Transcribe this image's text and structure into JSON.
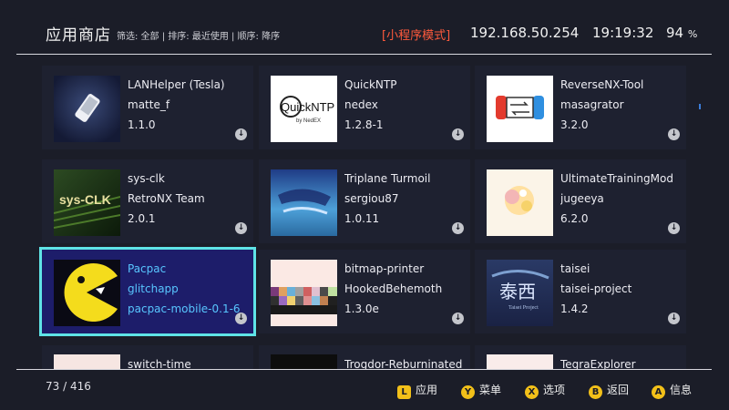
{
  "header": {
    "title": "应用商店",
    "filter_info": "筛选: 全部 | 排序: 最近使用 | 顺序: 降序",
    "mode": "[小程序模式]",
    "ip": "192.168.50.254",
    "time": "19:19:32",
    "battery": "94",
    "battery_unit": "%"
  },
  "apps": [
    {
      "name": "LANHelper (Tesla)",
      "author": "matte_f",
      "version": "1.1.0",
      "icon": "phone-icon"
    },
    {
      "name": "QuickNTP",
      "author": "nedex",
      "version": "1.2.8-1",
      "icon": "quickntp-logo"
    },
    {
      "name": "ReverseNX-Tool",
      "author": "masagrator",
      "version": "3.2.0",
      "icon": "reversenx-logo"
    },
    {
      "name": "sys-clk",
      "author": "RetroNX Team",
      "version": "2.0.1",
      "icon": "sys-clk-logo"
    },
    {
      "name": "Triplane Turmoil",
      "author": "sergiou87",
      "version": "1.0.11",
      "icon": "triplane-logo"
    },
    {
      "name": "UltimateTrainingMod",
      "author": "jugeeya",
      "version": "6.2.0",
      "icon": "training-mod-logo"
    },
    {
      "name": "Pacpac",
      "author": "glitchapp",
      "version": "pacpac-mobile-0.1-6",
      "icon": "pacman-icon"
    },
    {
      "name": "bitmap-printer",
      "author": "HookedBehemoth",
      "version": "1.3.0e",
      "icon": "bitmap-printer-logo"
    },
    {
      "name": "taisei",
      "author": "taisei-project",
      "version": "1.4.2",
      "icon": "taisei-logo"
    },
    {
      "name": "switch-time",
      "author": "",
      "version": "",
      "icon": ""
    },
    {
      "name": "Trogdor-Reburninated",
      "author": "",
      "version": "",
      "icon": ""
    },
    {
      "name": "TegraExplorer",
      "author": "",
      "version": "",
      "icon": ""
    }
  ],
  "taisei_logo_text": "泰西",
  "taisei_logo_sub": "Taisei Project",
  "quickntp_logo_text": "QuickNTP",
  "quickntp_logo_sub": "by NedEX",
  "sysclk_logo_text": "sys-CLK",
  "footer": {
    "count": "73 / 416",
    "hints": [
      {
        "key": "L",
        "label": "应用"
      },
      {
        "key": "Y",
        "label": "菜单"
      },
      {
        "key": "X",
        "label": "选项"
      },
      {
        "key": "B",
        "label": "返回"
      },
      {
        "key": "A",
        "label": "信息"
      }
    ]
  },
  "colors": {
    "background": "#1b1d28",
    "selected_bg": "#1d1d6a",
    "selected_border": "#5fe3e6",
    "selected_text": "#58c6ff",
    "mode_text": "#ff5a3c",
    "button_glyph": "#f2c019"
  }
}
